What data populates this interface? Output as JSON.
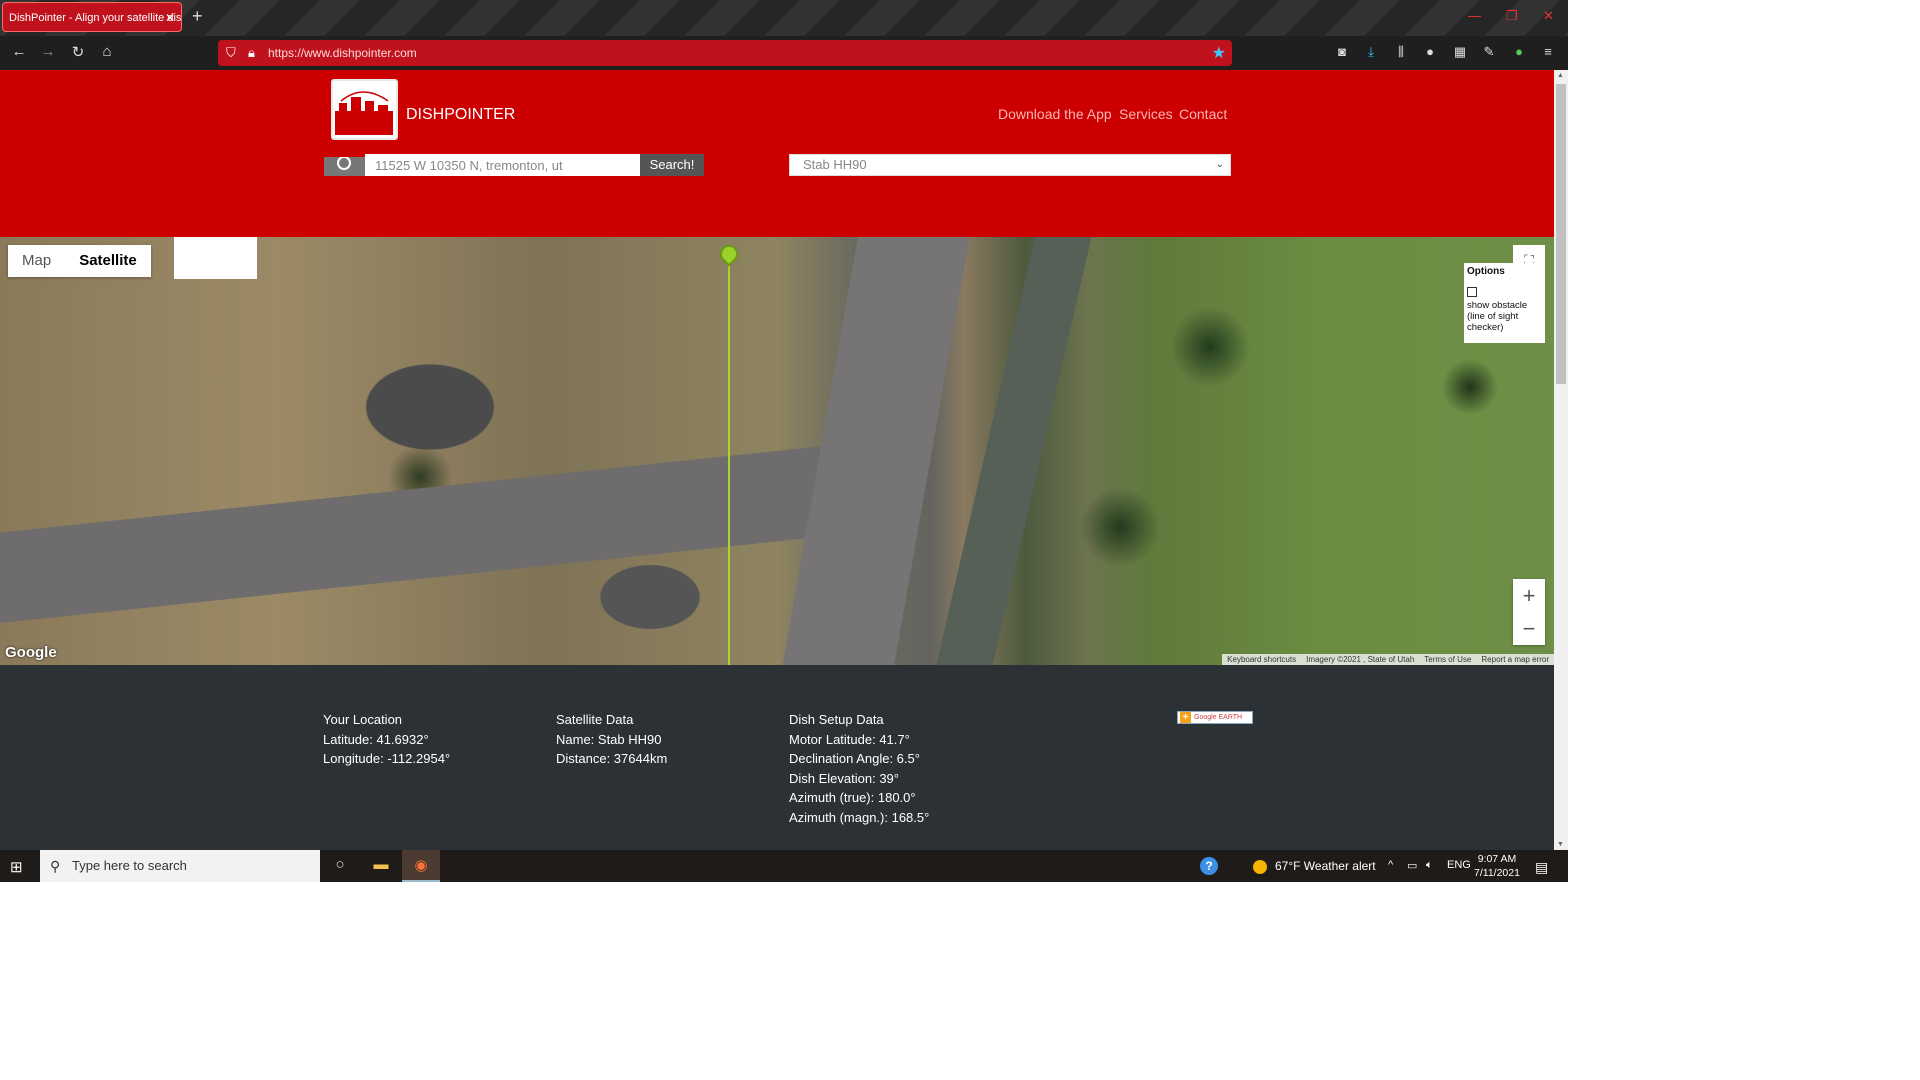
{
  "browser": {
    "tab_title": "DishPointer - Align your satellite dis",
    "tab_close": "✕",
    "new_tab": "+",
    "url": "https://www.dishpointer.com",
    "accent": "#c0121d"
  },
  "site": {
    "brand": "DISHPOINTER",
    "nav": {
      "download": "Download the App",
      "services": "Services",
      "contact": "Contact"
    },
    "search": {
      "value": "11525 W 10350 N, tremonton, ut",
      "button": "Search!"
    },
    "satellite_select": {
      "value": "Stab HH90"
    },
    "header_color": "#cc0000"
  },
  "map": {
    "type_map": "Map",
    "type_satellite": "Satellite",
    "options_title": "Options",
    "options_label": "show obstacle (line of sight checker)",
    "zoom_in": "+",
    "zoom_out": "−",
    "google": "Google",
    "attribution": {
      "keyboard": "Keyboard shortcuts",
      "imagery": "Imagery ©2021 , State of Utah",
      "terms": "Terms of Use",
      "report": "Report a map error"
    }
  },
  "info": {
    "location": {
      "title": "Your Location",
      "latitude": "Latitude: 41.6932°",
      "longitude": "Longitude: -112.2954°"
    },
    "satellite": {
      "title": "Satellite Data",
      "name": "Name: Stab HH90",
      "distance": "Distance: 37644km"
    },
    "dish": {
      "title": "Dish Setup Data",
      "motor": "Motor Latitude:  41.7°",
      "declination": "Declination Angle:  6.5°",
      "elevation": "Dish Elevation:  39°",
      "azimuth_true": "Azimuth (true):  180.0°",
      "azimuth_magn": "Azimuth (magn.):  168.5°"
    },
    "google_earth": "Google EARTH"
  },
  "taskbar": {
    "search_placeholder": "Type here to search",
    "weather": "67°F  Weather alert",
    "lang": "ENG",
    "time": "9:07 AM",
    "date": "7/11/2021"
  }
}
